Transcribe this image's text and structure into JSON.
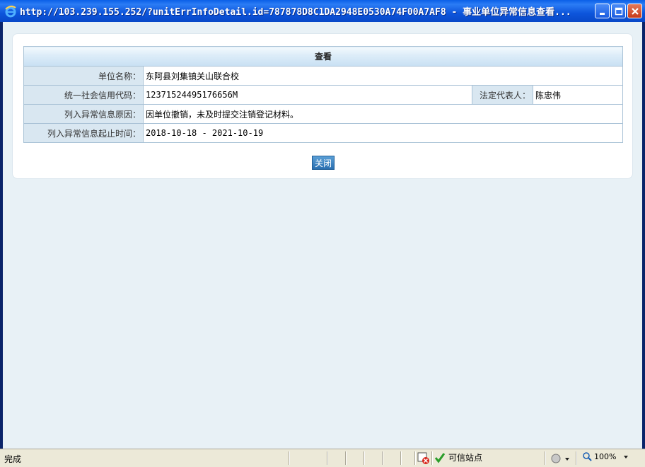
{
  "window": {
    "title": "http://103.239.155.252/?unitErrInfoDetail.id=787878D8C1DA2948E0530A74F00A7AF8 - 事业单位异常信息查看..."
  },
  "panel": {
    "header": "查看",
    "rows": {
      "unit_name_label": "单位名称：",
      "unit_name_value": "东阿县刘集镇关山联合校",
      "credit_code_label": "统一社会信用代码：",
      "credit_code_value": "12371524495176656M",
      "legal_rep_label": "法定代表人：",
      "legal_rep_value": "陈忠伟",
      "reason_label": "列入异常信息原因：",
      "reason_value": "因单位撤销，未及时提交注销登记材料。",
      "period_label": "列入异常信息起止时间：",
      "period_value": "2018-10-18 - 2021-10-19"
    },
    "close_button": "关闭"
  },
  "statusbar": {
    "status": "完成",
    "zone": "可信站点",
    "zoom": "100%"
  },
  "colors": {
    "title_bar": "#0a5fe8",
    "client_bg": "#e8f1f6",
    "label_bg": "#d9e7f1",
    "border": "#a9c2d6",
    "button": "#2a6fb0"
  }
}
